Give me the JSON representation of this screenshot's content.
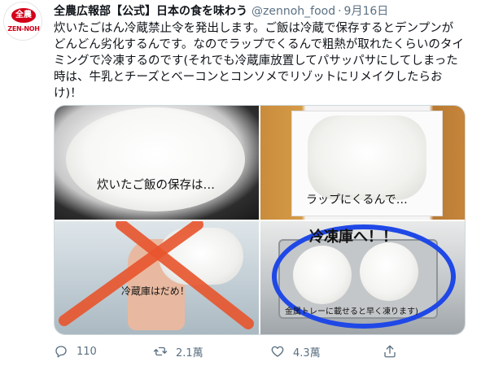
{
  "tweet": {
    "author_name": "全農広報部【公式】日本の食を味わう",
    "handle": "@zennoh_food",
    "separator": "·",
    "date": "9月16日",
    "avatar": {
      "logo_mark": "全農",
      "logo_text": "ZEN-NOH"
    },
    "text": "炊いたごはん冷蔵禁止令を発出します。ご飯は冷蔵で保存するとデンプンがどんどん劣化するんです。なのでラップでくるんで粗熱が取れたくらいのタイミングで冷凍するのです(それでも冷蔵庫放置してパサッパサにしてしまった時は、牛乳とチーズとベーコンとコンソメでリゾットにリメイクしたらおけ)！"
  },
  "media": {
    "captions": [
      "炊いたご飯の保存は…",
      "ラップにくるんで…",
      "冷蔵庫はだめ！",
      "冷凍庫へ！！",
      "金属トレーに載せると早く凍ります)"
    ]
  },
  "actions": {
    "reply": {
      "icon": "reply-icon",
      "count": "110"
    },
    "retweet": {
      "icon": "retweet-icon",
      "count": "2.1萬"
    },
    "like": {
      "icon": "heart-icon",
      "count": "4.3萬"
    },
    "share": {
      "icon": "share-icon",
      "count": ""
    }
  },
  "colors": {
    "muted": "#5b7083",
    "brand_red": "#d4001a",
    "cross_red": "#e8552d",
    "highlight_blue": "#1f48e6"
  }
}
